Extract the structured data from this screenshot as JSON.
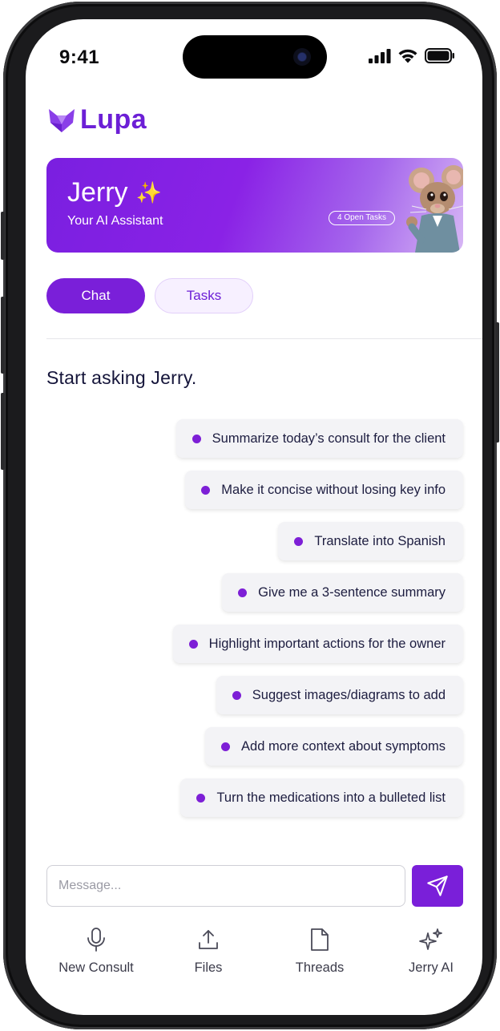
{
  "status_bar": {
    "time": "9:41"
  },
  "brand": {
    "name": "Lupa",
    "color": "#6c1fd6"
  },
  "hero": {
    "title": "Jerry",
    "sparkle": "✨",
    "subtitle": "Your AI Assistant",
    "badge": "4 Open Tasks"
  },
  "tabs": [
    {
      "label": "Chat",
      "active": true
    },
    {
      "label": "Tasks",
      "active": false
    }
  ],
  "heading": "Start asking Jerry.",
  "suggestions": [
    "Summarize today’s consult for the client",
    "Make it concise without losing key info",
    "Translate into Spanish",
    "Give me a 3-sentence summary",
    "Highlight important actions for the owner",
    "Suggest images/diagrams to add",
    "Add more context about symptoms",
    "Turn the medications into a bulleted list"
  ],
  "composer": {
    "placeholder": "Message...",
    "value": ""
  },
  "nav": [
    {
      "label": "New Consult",
      "icon": "microphone-icon"
    },
    {
      "label": "Files",
      "icon": "upload-icon"
    },
    {
      "label": "Threads",
      "icon": "document-icon"
    },
    {
      "label": "Jerry AI",
      "icon": "sparkles-icon"
    }
  ],
  "colors": {
    "accent": "#7a1fd9",
    "dot": "#7d1fd6",
    "text_dark": "#15153a"
  }
}
